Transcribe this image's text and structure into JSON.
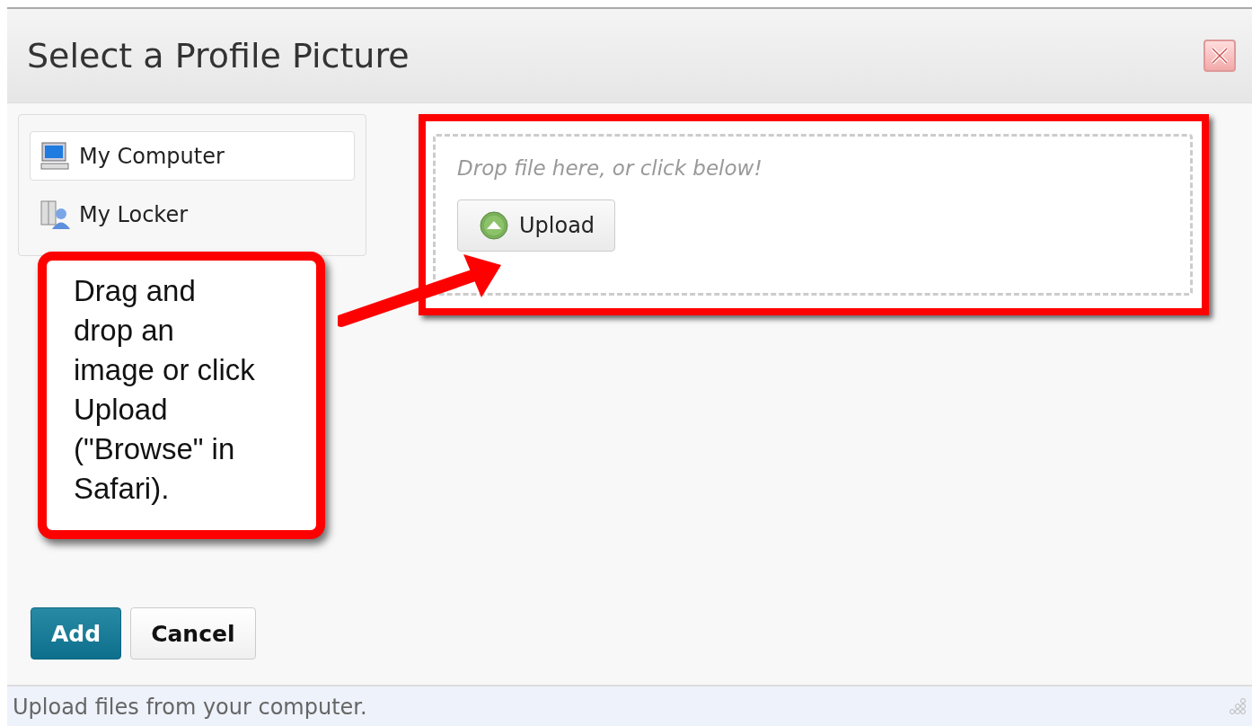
{
  "dialog": {
    "title": "Select a Profile Picture"
  },
  "sources": [
    {
      "label": "My Computer",
      "selected": true,
      "kind": "computer"
    },
    {
      "label": "My Locker",
      "selected": false,
      "kind": "locker"
    }
  ],
  "drop_zone": {
    "hint": "Drop file here, or click below!",
    "upload_button": "Upload",
    "highlighted": true
  },
  "callout": {
    "text": "Drag and drop an image or click Upload (\"Browse\" in Safari)."
  },
  "buttons": [
    {
      "label": "Add",
      "kind": "primary"
    },
    {
      "label": "Cancel",
      "kind": "secondary"
    }
  ],
  "status_bar": "Upload files from your computer."
}
